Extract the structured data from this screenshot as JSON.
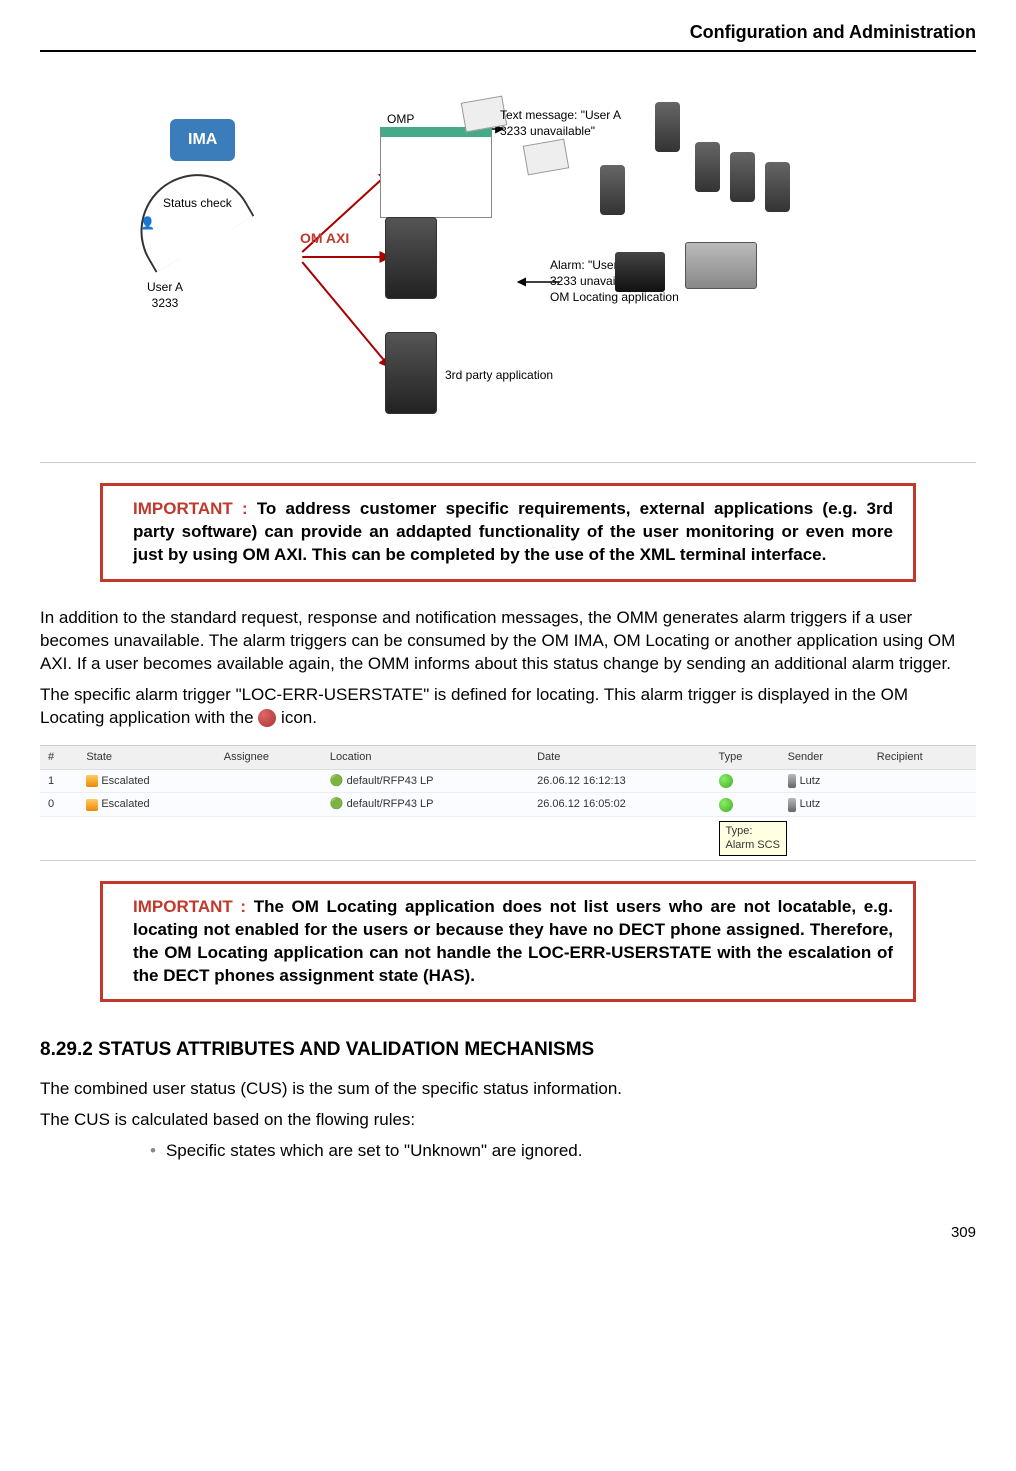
{
  "header": "Configuration and Administration",
  "diagram": {
    "ima": "IMA",
    "status_check": "Status check",
    "user_a": "User A",
    "user_a_num": "3233",
    "om_axi": "OM AXI",
    "omp": "OMP",
    "text_msg": "Text message: \"User A\n3233 unavailable\"",
    "alarm_msg": "Alarm: \"User A\n3233 unavailable\"",
    "om_locating_app": "OM Locating application",
    "third_party": "3rd party application"
  },
  "important1": {
    "label": "IMPORTANT : ",
    "text": "To address customer specific requirements, external applications (e.g. 3rd party software) can provide an addapted functionality of the user monitoring or even more just by using OM AXI. This can be completed by the use of the XML terminal interface."
  },
  "para1": "In addition to the standard request, response and notification messages, the OMM generates alarm triggers if a user becomes unavailable. The alarm triggers can be consumed by the OM IMA, OM Locating or another application using OM AXI. If a user becomes available again, the OMM informs about this status change by sending an additional alarm trigger.",
  "para2a": "The specific alarm trigger \"LOC-ERR-USERSTATE\" is defined for locating. This alarm trigger is displayed in the OM Locating application with the ",
  "para2b": " icon.",
  "table": {
    "headers": {
      "num": "#",
      "state": "State",
      "assignee": "Assignee",
      "location": "Location",
      "date": "Date",
      "type": "Type",
      "sender": "Sender",
      "recipient": "Recipient"
    },
    "rows": [
      {
        "num": "1",
        "state": "Escalated",
        "assignee": "",
        "location": "default/RFP43 LP",
        "date": "26.06.12 16:12:13",
        "type_icon": "green",
        "sender": "Lutz",
        "recipient": ""
      },
      {
        "num": "0",
        "state": "Escalated",
        "assignee": "",
        "location": "default/RFP43 LP",
        "date": "26.06.12 16:05:02",
        "type_icon": "green",
        "sender": "Lutz",
        "recipient": ""
      }
    ],
    "tooltip": "Type:\nAlarm SCS"
  },
  "important2": {
    "label": "IMPORTANT : ",
    "text": "The OM Locating application does not list users who are not locatable, e.g. locating not enabled for the users or because they have no DECT phone assigned. Therefore, the OM Locating application can not handle the LOC-ERR-USERSTATE with the escalation of the DECT phones assignment state (HAS)."
  },
  "section_heading": "8.29.2 STATUS ATTRIBUTES AND VALIDATION MECHANISMS",
  "para3": "The combined user status (CUS) is the sum of the specific status information.",
  "para4": "The CUS is calculated based on the flowing rules:",
  "bullets": [
    "Specific states which are set to \"Unknown\" are ignored."
  ],
  "page_number": "309"
}
